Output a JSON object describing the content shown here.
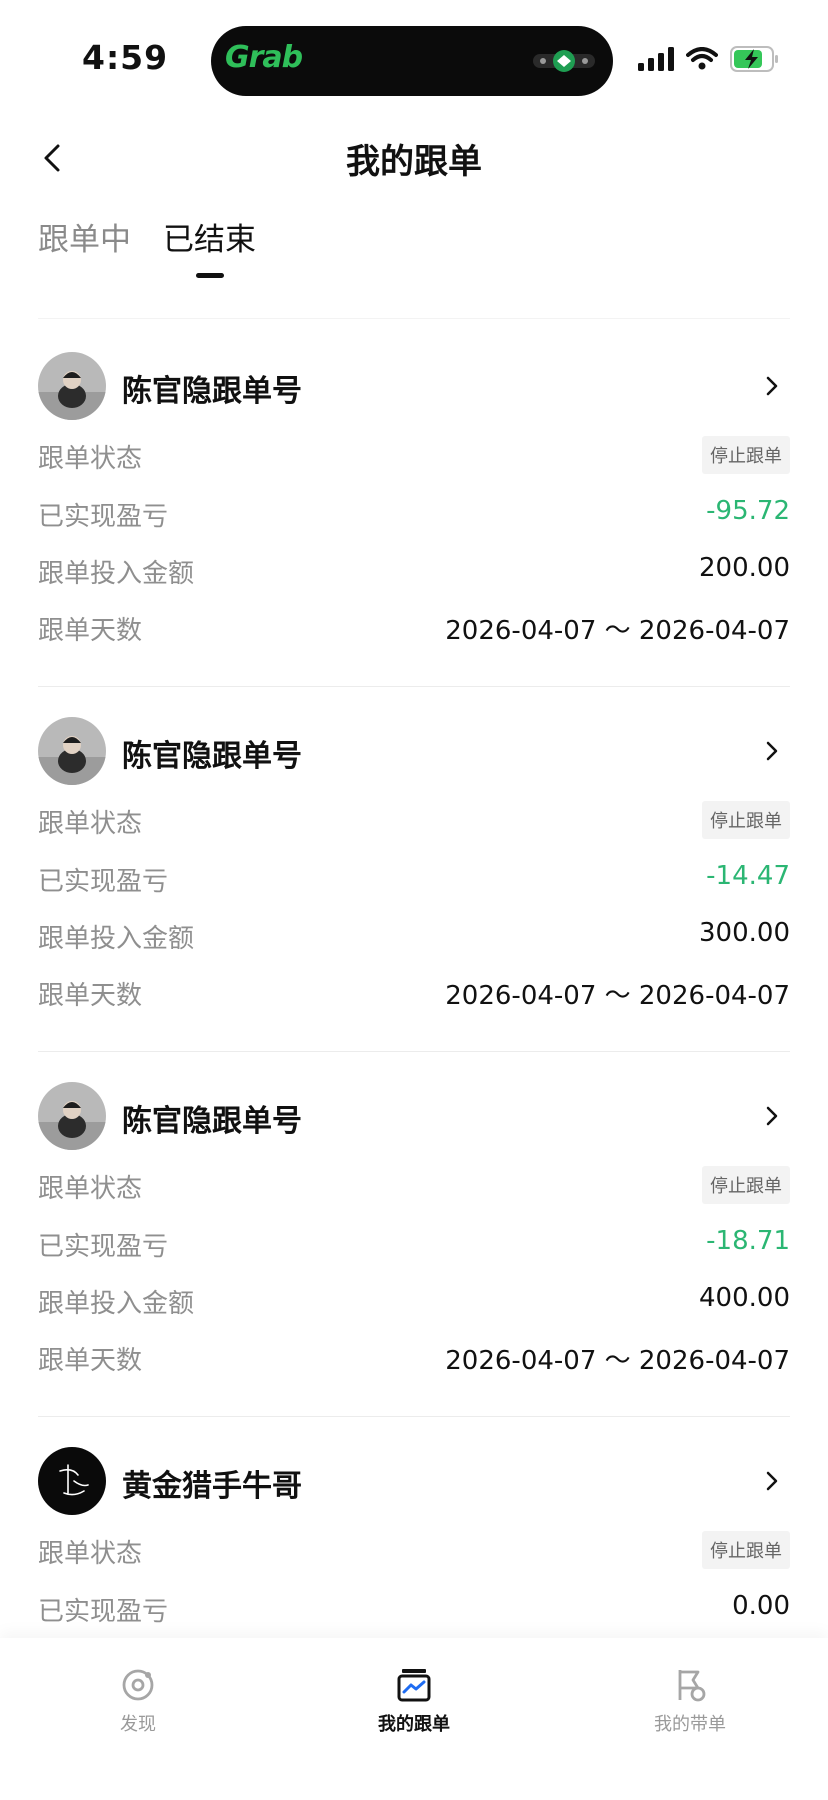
{
  "status_bar": {
    "time": "4:59",
    "island_app": "Grab",
    "icons": [
      "signal-icon",
      "wifi-icon",
      "battery-charging-icon"
    ]
  },
  "nav": {
    "title": "我的跟单",
    "back_icon": "chevron-left-icon"
  },
  "tabs": [
    {
      "label": "跟单中",
      "active": false
    },
    {
      "label": "已结束",
      "active": true
    }
  ],
  "colors": {
    "profit_negative": "#2bb673",
    "text_primary": "#111111",
    "text_secondary": "#8f8f8f",
    "badge_bg": "#f3f3f3"
  },
  "cards": [
    {
      "name": "陈官隐跟单号",
      "status_label": "跟单状态",
      "status_value": "停止跟单",
      "pnl_label": "已实现盈亏",
      "pnl_value": "-95.72",
      "amount_label": "跟单投入金额",
      "amount_value": "200.00",
      "days_label": "跟单天数",
      "days_value": "2026-04-07 ～ 2026-04-07"
    },
    {
      "name": "陈官隐跟单号",
      "status_label": "跟单状态",
      "status_value": "停止跟单",
      "pnl_label": "已实现盈亏",
      "pnl_value": "-14.47",
      "amount_label": "跟单投入金额",
      "amount_value": "300.00",
      "days_label": "跟单天数",
      "days_value": "2026-04-07 ～ 2026-04-07"
    },
    {
      "name": "陈官隐跟单号",
      "status_label": "跟单状态",
      "status_value": "停止跟单",
      "pnl_label": "已实现盈亏",
      "pnl_value": "-18.71",
      "amount_label": "跟单投入金额",
      "amount_value": "400.00",
      "days_label": "跟单天数",
      "days_value": "2026-04-07 ～ 2026-04-07"
    },
    {
      "name": "黄金猎手牛哥",
      "status_label": "跟单状态",
      "status_value": "停止跟单",
      "pnl_label": "已实现盈亏",
      "pnl_value": "0.00"
    }
  ],
  "tabbar": [
    {
      "label": "发现",
      "icon": "discover-icon",
      "active": false
    },
    {
      "label": "我的跟单",
      "icon": "copy-trade-icon",
      "active": true
    },
    {
      "label": "我的带单",
      "icon": "lead-trade-icon",
      "active": false
    }
  ]
}
